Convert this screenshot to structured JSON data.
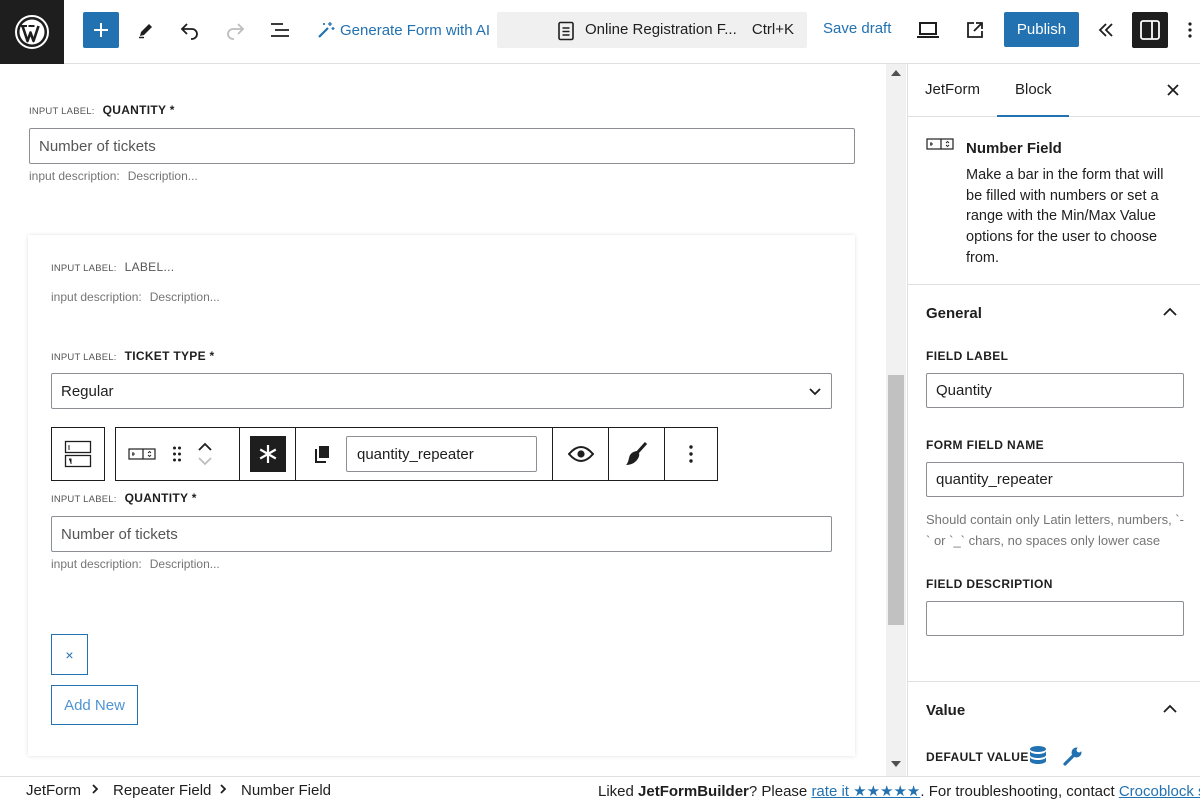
{
  "topbar": {
    "generate_ai_label": "Generate Form with AI",
    "doc_title": "Online Registration F...",
    "shortcut": "Ctrl+K",
    "save_draft_label": "Save draft",
    "publish_label": "Publish"
  },
  "canvas": {
    "input_label_tag": "INPUT LABEL:",
    "input_desc_tag": "input description:",
    "desc_placeholder": "Description...",
    "top_field": {
      "label": "QUANTITY *",
      "placeholder": "Number of tickets"
    },
    "repeater": {
      "first_label": "LABEL...",
      "ticket_label": "TICKET TYPE *",
      "ticket_value": "Regular",
      "quantity_label": "QUANTITY *",
      "quantity_placeholder": "Number of tickets",
      "remove_label": "×",
      "add_new_label": "Add New"
    },
    "block_toolbar": {
      "field_name": "quantity_repeater"
    }
  },
  "sidebar": {
    "tabs": [
      {
        "label": "JetForm"
      },
      {
        "label": "Block",
        "active": true
      }
    ],
    "block_title": "Number Field",
    "block_description": "Make a bar in the form that will be filled with numbers or set a range with the Min/Max Value options for the user to choose from.",
    "general_label": "General",
    "field_label_heading": "FIELD LABEL",
    "field_label_value": "Quantity",
    "form_field_name_heading": "FORM FIELD NAME",
    "form_field_name_value": "quantity_repeater",
    "name_help": "Should contain only Latin letters, numbers, `-` or `_` chars, no spaces only lower case",
    "field_description_heading": "FIELD DESCRIPTION",
    "field_description_value": "",
    "value_label": "Value",
    "default_value_heading": "DEFAULT VALUE"
  },
  "footer": {
    "breadcrumbs": [
      "JetForm",
      "Repeater Field",
      "Number Field"
    ],
    "note_prefix": "Liked ",
    "note_brand": "JetFormBuilder",
    "note_mid": "? Please ",
    "note_link": "rate it ★★★★★",
    "note_suffix": ". For troubleshooting, contact ",
    "note_support": "Crocoblock support"
  },
  "colors": {
    "accent": "#2271b1",
    "dark": "#1e1e1e",
    "border": "#e0e0e0"
  }
}
